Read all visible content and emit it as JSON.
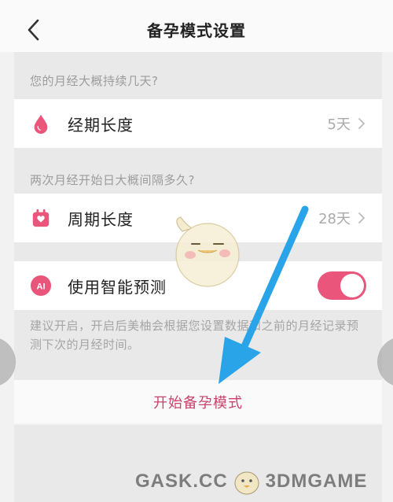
{
  "header": {
    "title": "备孕模式设置"
  },
  "period_section": {
    "hint": "您的月经大概持续几天?",
    "label": "经期长度",
    "value": "5天"
  },
  "cycle_section": {
    "hint": "两次月经开始日大概间隔多久?",
    "label": "周期长度",
    "value": "28天"
  },
  "smart_predict": {
    "icon_text": "AI",
    "label": "使用智能预测",
    "enabled": true,
    "advice": "建议开启，开启后美柚会根据您设置数据和之前的月经记录预测下次的月经时间。"
  },
  "start_button": {
    "label": "开始备孕模式"
  },
  "watermark": {
    "left": "GASK.CC",
    "right": "3DMGAME"
  },
  "colors": {
    "accent": "#e9557b",
    "start_text": "#c9426c",
    "overlay_arrow": "#2aa4e8"
  }
}
